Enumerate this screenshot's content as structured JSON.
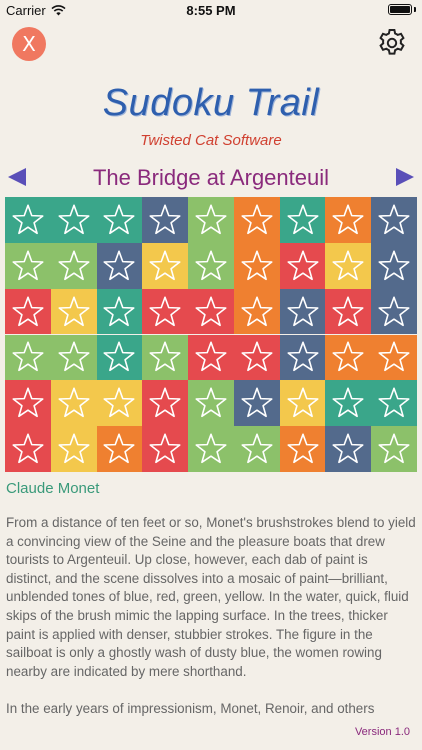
{
  "status_bar": {
    "carrier": "Carrier",
    "time": "8:55 PM"
  },
  "controls": {
    "close_label": "X"
  },
  "logo": {
    "title": "Sudoku Trail",
    "subtitle": "Twisted Cat Software"
  },
  "puzzle": {
    "title": "The Bridge at Argenteuil",
    "artist": "Claude Monet"
  },
  "colors": {
    "T": "#3aa68a",
    "L": "#8cc16a",
    "N": "#536a8c",
    "O": "#ef8030",
    "R": "#e54a4e",
    "Y": "#f3c84c",
    "background": "#f3efe8",
    "accent_purple": "#8a2a7c",
    "nav_arrow": "#5a4fb8",
    "close_button": "#f07860"
  },
  "grid_rows": [
    [
      "T",
      "T",
      "T",
      "N",
      "L",
      "O",
      "T",
      "O",
      "N"
    ],
    [
      "L",
      "L",
      "N",
      "Y",
      "L",
      "O",
      "R",
      "Y",
      "N"
    ],
    [
      "R",
      "Y",
      "T",
      "R",
      "R",
      "O",
      "N",
      "R",
      "N"
    ],
    [
      "L",
      "L",
      "T",
      "L",
      "R",
      "R",
      "N",
      "O",
      "O"
    ],
    [
      "R",
      "Y",
      "Y",
      "R",
      "L",
      "N",
      "Y",
      "T",
      "T"
    ],
    [
      "R",
      "Y",
      "O",
      "R",
      "L",
      "L",
      "O",
      "N",
      "L"
    ]
  ],
  "description": [
    "From a distance of ten feet or so, Monet's brushstrokes blend to yield a convincing view of the Seine and the pleasure boats that drew tourists to Argenteuil. Up close, however, each dab of paint is distinct, and the scene dissolves into a mosaic of paint—brilliant, unblended tones of blue, red, green, yellow. In the water, quick, fluid skips of the brush mimic the lapping surface. In the trees, thicker paint is applied with denser, stubbier strokes. The figure in the sailboat is only a ghostly wash of dusty blue, the women rowing nearby are indicated by mere shorthand.",
    "In the early years of impressionism, Monet, Renoir, and others"
  ],
  "version": "Version 1.0"
}
